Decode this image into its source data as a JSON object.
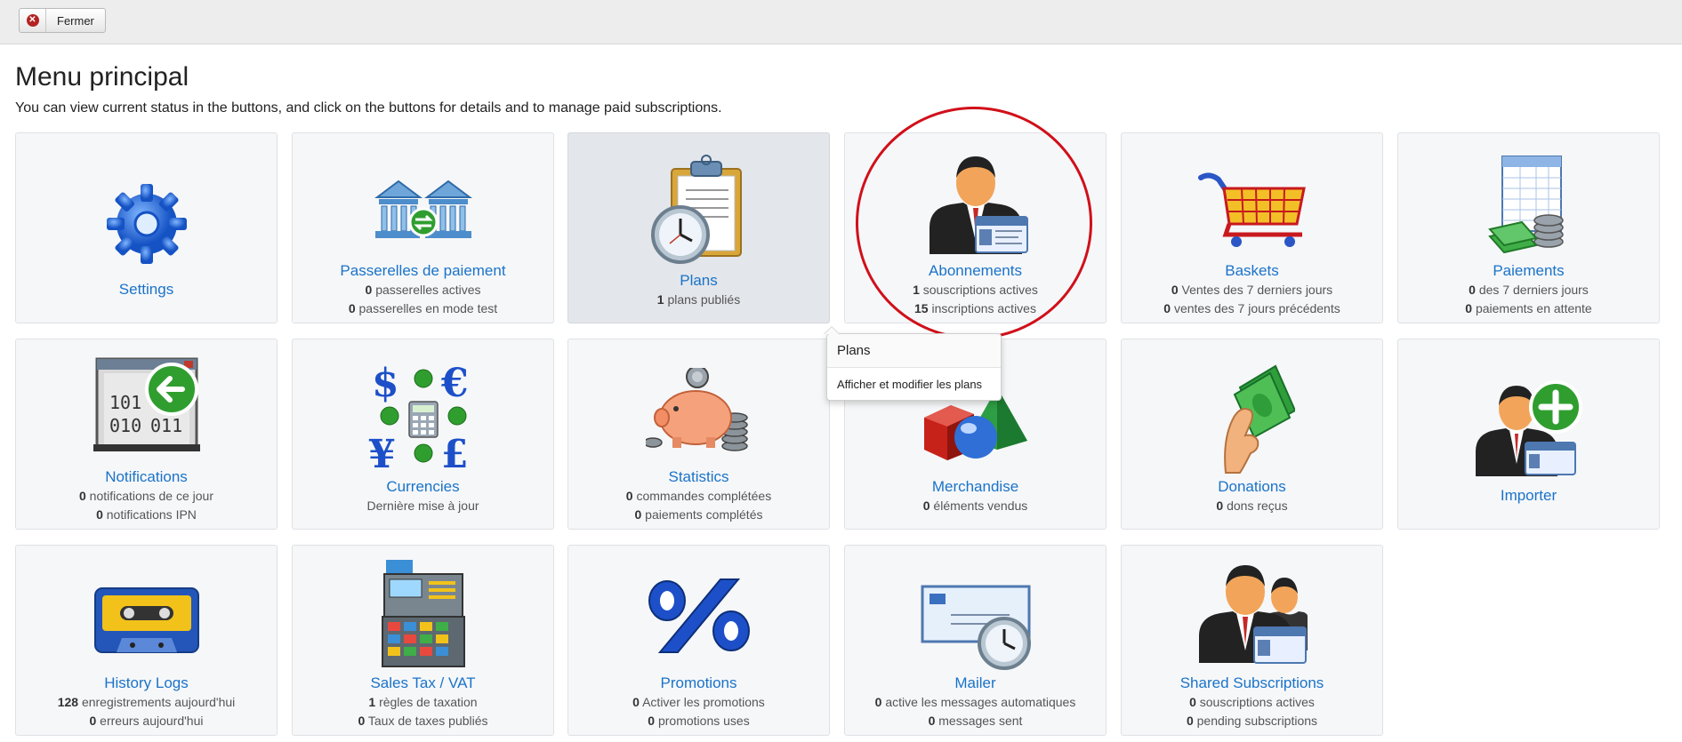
{
  "toolbar": {
    "close_label": "Fermer"
  },
  "page": {
    "title": "Menu principal",
    "intro": "You can view current status in the buttons, and click on the buttons for details and to manage paid subscriptions."
  },
  "tiles": [
    {
      "label": "Settings",
      "icon": "gear-icon",
      "stats": []
    },
    {
      "label": "Passerelles de paiement",
      "icon": "bank-icon",
      "stats": [
        {
          "num": "0",
          "text": " passerelles actives"
        },
        {
          "num": "0",
          "text": " passerelles en mode test"
        }
      ]
    },
    {
      "label": "Plans",
      "icon": "clipboard-clock-icon",
      "stats": [
        {
          "num": "1",
          "text": " plans publiés"
        }
      ]
    },
    {
      "label": "Abonnements",
      "icon": "user-card-icon",
      "stats": [
        {
          "num": "1",
          "text": " souscriptions actives"
        },
        {
          "num": "15",
          "text": " inscriptions actives"
        }
      ]
    },
    {
      "label": "Baskets",
      "icon": "shopping-cart-icon",
      "stats": [
        {
          "num": "0",
          "text": " Ventes des 7 derniers jours"
        },
        {
          "num": "0",
          "text": " ventes des 7 jours précédents"
        }
      ]
    },
    {
      "label": "Paiements",
      "icon": "spreadsheet-money-icon",
      "stats": [
        {
          "num": "0",
          "text": " des 7 derniers jours"
        },
        {
          "num": "0",
          "text": " paiements en attente"
        }
      ]
    },
    {
      "label": "Notifications",
      "icon": "binary-window-icon",
      "stats": [
        {
          "num": "0",
          "text": " notifications de ce jour"
        },
        {
          "num": "0",
          "text": " notifications IPN"
        }
      ]
    },
    {
      "label": "Currencies",
      "icon": "currency-exchange-icon",
      "stats": [
        {
          "num": "",
          "text": "Dernière mise à jour"
        }
      ]
    },
    {
      "label": "Statistics",
      "icon": "piggy-bank-icon",
      "stats": [
        {
          "num": "0",
          "text": " commandes complétées"
        },
        {
          "num": "0",
          "text": " paiements complétés"
        }
      ]
    },
    {
      "label": "Merchandise",
      "icon": "shapes-icon",
      "stats": [
        {
          "num": "0",
          "text": " éléments vendus"
        }
      ]
    },
    {
      "label": "Donations",
      "icon": "hand-money-icon",
      "stats": [
        {
          "num": "0",
          "text": " dons reçus"
        }
      ]
    },
    {
      "label": "Importer",
      "icon": "user-add-icon",
      "stats": []
    },
    {
      "label": "History Logs",
      "icon": "cassette-icon",
      "stats": [
        {
          "num": "128",
          "text": " enregistrements aujourd'hui"
        },
        {
          "num": "0",
          "text": " erreurs aujourd'hui"
        }
      ]
    },
    {
      "label": "Sales Tax / VAT",
      "icon": "cash-register-icon",
      "stats": [
        {
          "num": "1",
          "text": " règles de taxation"
        },
        {
          "num": "0",
          "text": " Taux de taxes publiés"
        }
      ]
    },
    {
      "label": "Promotions",
      "icon": "percent-icon",
      "stats": [
        {
          "num": "0",
          "text": " Activer les promotions"
        },
        {
          "num": "0",
          "text": " promotions uses"
        }
      ]
    },
    {
      "label": "Mailer",
      "icon": "envelope-clock-icon",
      "stats": [
        {
          "num": "0",
          "text": " active les messages automatiques"
        },
        {
          "num": "0",
          "text": " messages sent"
        }
      ]
    },
    {
      "label": "Shared Subscriptions",
      "icon": "users-card-icon",
      "stats": [
        {
          "num": "0",
          "text": " souscriptions actives"
        },
        {
          "num": "0",
          "text": " pending subscriptions"
        }
      ]
    }
  ],
  "tooltip": {
    "title": "Plans",
    "body": "Afficher et modifier les plans"
  },
  "colors": {
    "link": "#1a73c9",
    "tile_bg": "#f6f7f9",
    "tile_hover_bg": "#e3e6ea",
    "highlight_circle": "#d0101a"
  }
}
